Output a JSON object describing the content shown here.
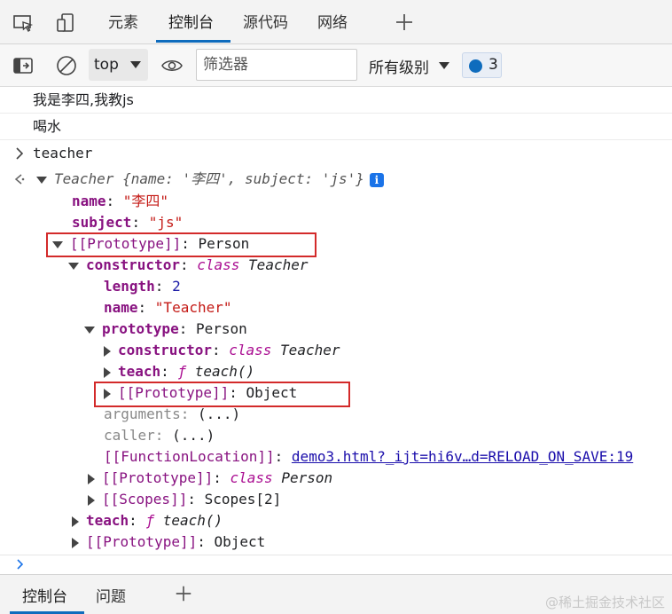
{
  "tabs": {
    "elements": "元素",
    "console": "控制台",
    "sources": "源代码",
    "network": "网络"
  },
  "toolbar": {
    "context": "top",
    "filter_placeholder": "筛选器",
    "levels": "所有级别",
    "message_count": "3"
  },
  "console": {
    "log1": "我是李四,我教js",
    "log2": "喝水",
    "input": "teacher",
    "preview_class": "Teacher",
    "preview_body": "{name: '李四', subject: 'js'}",
    "prop_name_key": "name",
    "prop_name_val": "\"李四\"",
    "prop_subject_key": "subject",
    "prop_subject_val": "\"js\"",
    "proto1_key": "[[Prototype]]",
    "proto1_val": "Person",
    "ctor_key": "constructor",
    "ctor_kw": "class",
    "ctor_val": "Teacher",
    "length_key": "length",
    "length_val": "2",
    "fname_key": "name",
    "fname_val": "\"Teacher\"",
    "prototype_key": "prototype",
    "prototype_val": "Person",
    "inner_ctor_key": "constructor",
    "inner_ctor_kw": "class",
    "inner_ctor_val": "Teacher",
    "inner_teach_key": "teach",
    "inner_teach_f": "ƒ",
    "inner_teach_val": "teach()",
    "inner_proto_key": "[[Prototype]]",
    "inner_proto_val": "Object",
    "arguments_key": "arguments",
    "arguments_val": "(...)",
    "caller_key": "caller",
    "caller_val": "(...)",
    "fnloc_key": "[[FunctionLocation]]",
    "fnloc_val": "demo3.html?_ijt=hi6v…d=RELOAD_ON_SAVE:19",
    "ctor_proto_key": "[[Prototype]]",
    "ctor_proto_kw": "class",
    "ctor_proto_val": "Person",
    "scopes_key": "[[Scopes]]",
    "scopes_val": "Scopes[2]",
    "teach_key": "teach",
    "teach_f": "ƒ",
    "teach_val": "teach()",
    "proto2_key": "[[Prototype]]",
    "proto2_val": "Object"
  },
  "drawer": {
    "console": "控制台",
    "issues": "问题"
  },
  "watermark": "@稀土掘金技术社区",
  "colors": {
    "accent": "#0f6cbd",
    "highlight_box": "#d32a2a",
    "property_key": "#881280",
    "string": "#c41a16"
  }
}
